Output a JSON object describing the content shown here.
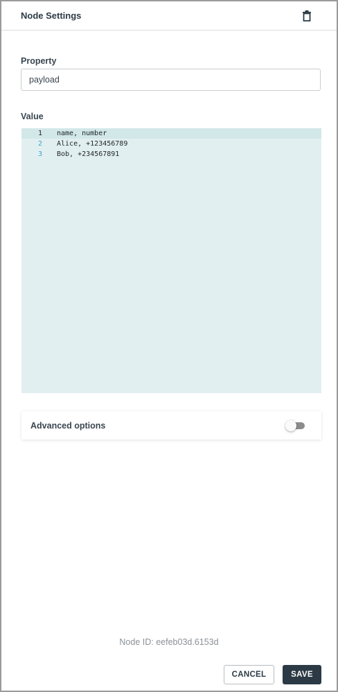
{
  "header": {
    "title": "Node Settings",
    "delete_icon": "trash-icon"
  },
  "property": {
    "label": "Property",
    "value": "payload"
  },
  "value_field": {
    "label": "Value",
    "lines": [
      {
        "number": "1",
        "text": "name, number"
      },
      {
        "number": "2",
        "text": "Alice, +123456789"
      },
      {
        "number": "3",
        "text": "Bob, +234567891"
      }
    ]
  },
  "advanced": {
    "label": "Advanced options",
    "enabled": false
  },
  "footer": {
    "node_id": "Node ID: eefeb03d.6153d",
    "cancel_label": "CANCEL",
    "save_label": "SAVE"
  },
  "colors": {
    "editor_bg": "#e2eff0",
    "save_bg": "#2b3a45",
    "line_number": "#3aa5c9"
  }
}
